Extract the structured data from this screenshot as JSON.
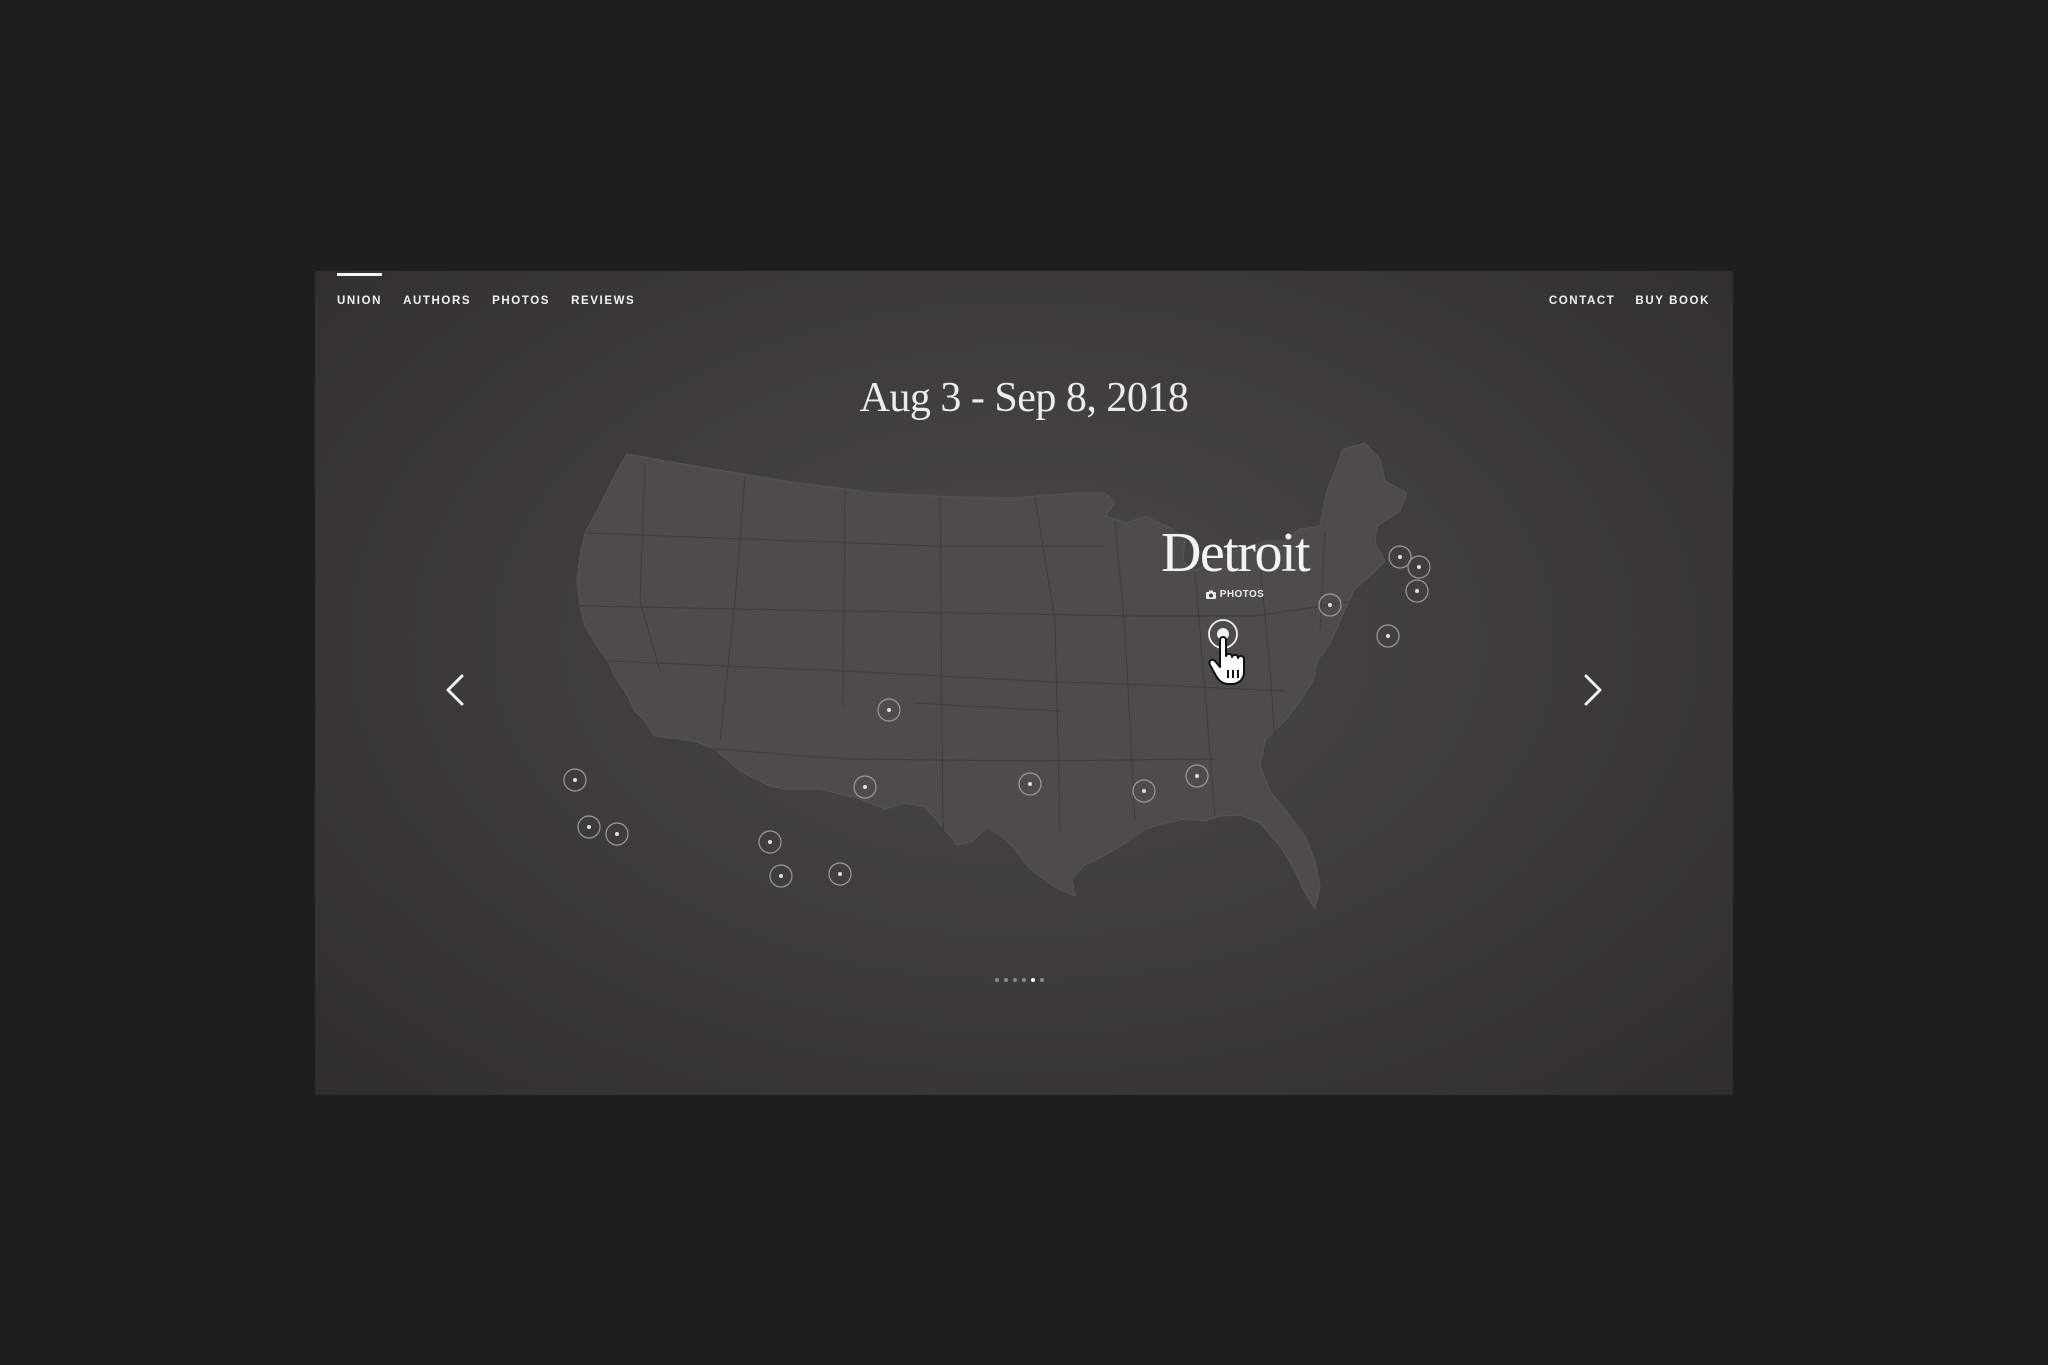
{
  "nav": {
    "left": [
      {
        "label": "UNION",
        "active": true
      },
      {
        "label": "AUTHORS"
      },
      {
        "label": "PHOTOS"
      },
      {
        "label": "REVIEWS"
      }
    ],
    "right": [
      {
        "label": "CONTACT"
      },
      {
        "label": "BUY BOOK"
      }
    ]
  },
  "tour": {
    "date_range": "Aug 3 - Sep 8, 2018",
    "selected_city": "Detroit",
    "photos_label": "PHOTOS"
  },
  "pagination": {
    "count": 6,
    "active_index": 4
  },
  "colors": {
    "background": "#1e1e1e",
    "map_fill": "#4d4c4b",
    "text": "#f2f2f2"
  },
  "icons": {
    "prev": "chevron-left-icon",
    "next": "chevron-right-icon",
    "camera": "camera-icon",
    "cursor": "hand-pointer-icon"
  }
}
